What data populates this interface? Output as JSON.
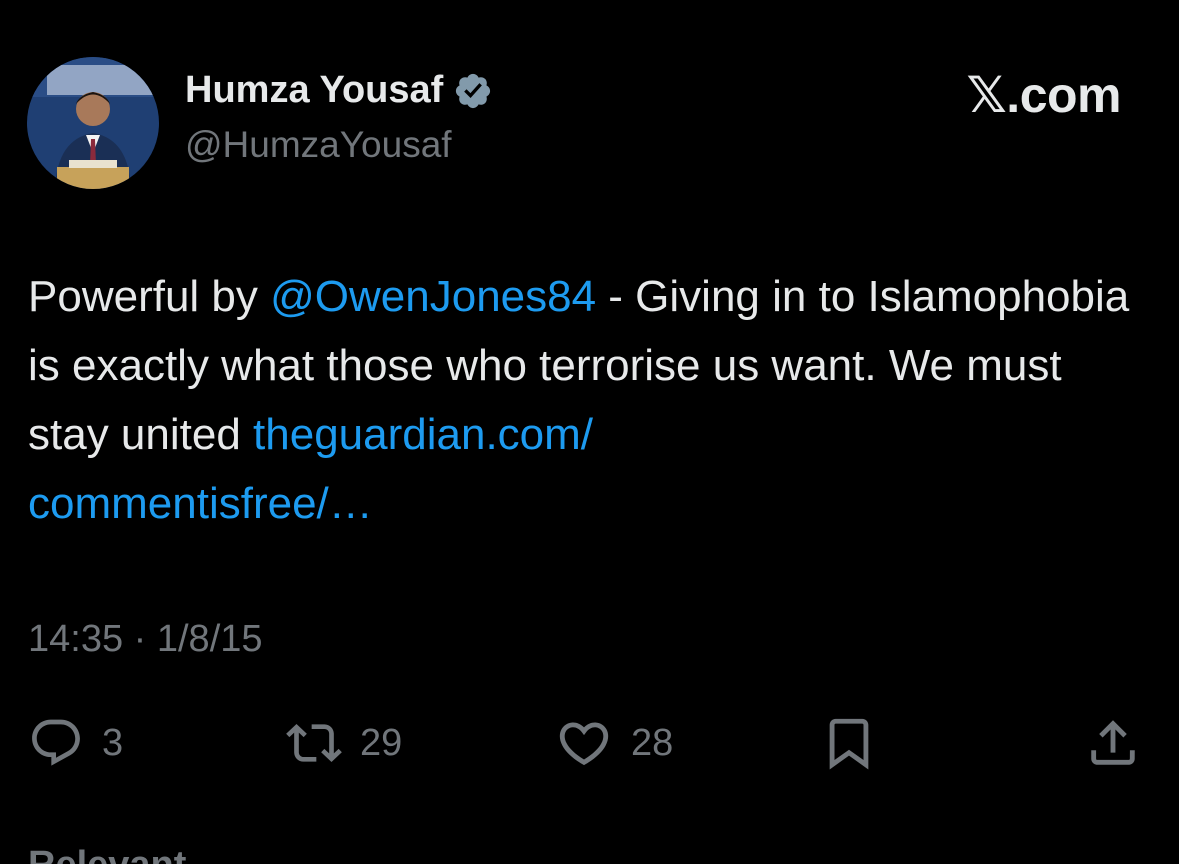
{
  "author": {
    "display_name": "Humza Yousaf",
    "handle": "@HumzaYousaf",
    "verified": true,
    "verified_icon": "verified-badge-icon"
  },
  "brand": "𝕏.com",
  "tweet": {
    "text_before_mention": "Powerful by ",
    "mention": "@OwenJones84",
    "text_after_mention": " - Giving in to Islamophobia is exactly what those who terrorise us want. We must stay united ",
    "link_line1": "theguardian.com/",
    "link_line2": "commentisfree/…"
  },
  "timestamp": "14:35 · 1/8/15",
  "actions": {
    "reply": {
      "icon": "reply-icon",
      "count": "3"
    },
    "retweet": {
      "icon": "retweet-icon",
      "count": "29"
    },
    "like": {
      "icon": "heart-icon",
      "count": "28"
    },
    "bookmark": {
      "icon": "bookmark-icon"
    },
    "share": {
      "icon": "share-icon"
    }
  },
  "sort_label": "Relevant",
  "colors": {
    "background": "#000000",
    "text": "#e7e9ea",
    "secondary": "#71767b",
    "link": "#1d9bf0"
  }
}
